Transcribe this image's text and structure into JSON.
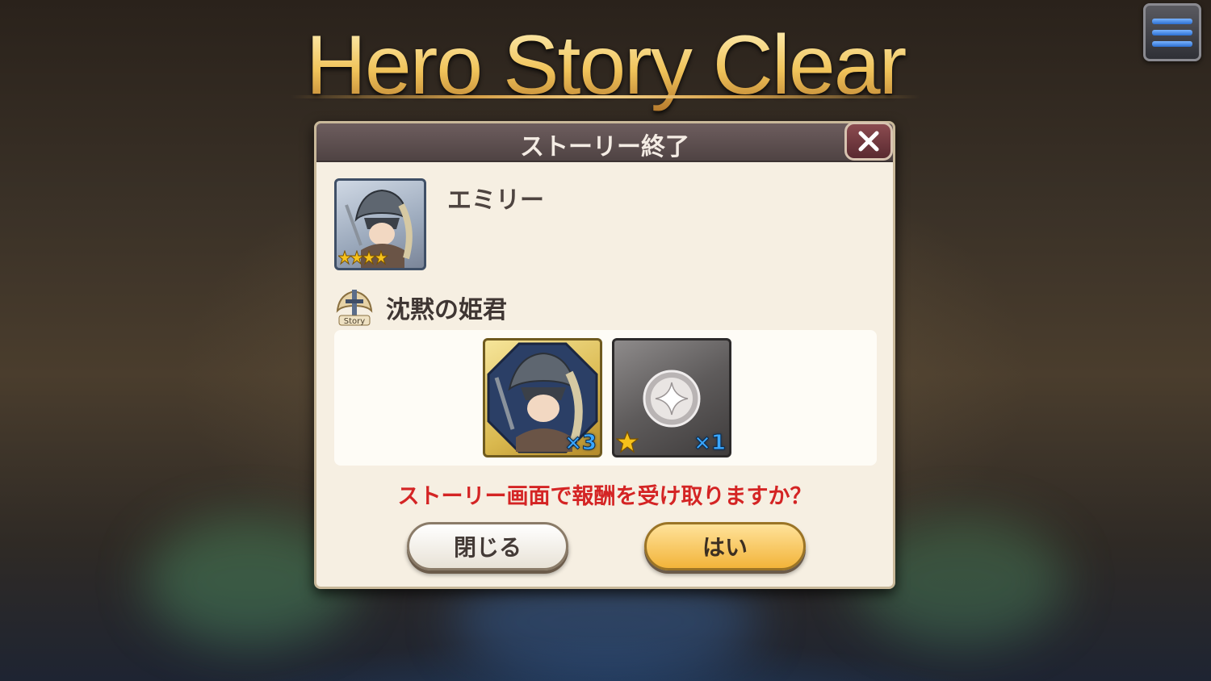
{
  "screen": {
    "title": "Hero Story Clear"
  },
  "menu": {
    "icon": "hamburger-menu-icon"
  },
  "dialog": {
    "title": "ストーリー終了",
    "close_icon": "close-icon",
    "hero": {
      "name": "エミリー",
      "rarity_stars": 4
    },
    "story": {
      "icon": "story-sword-icon",
      "name": "沈黙の姫君"
    },
    "rewards": [
      {
        "type": "hero-fragment",
        "quantity": "×3"
      },
      {
        "type": "silver-medal",
        "rarity_stars": 1,
        "quantity": "×1"
      }
    ],
    "question": "ストーリー画面で報酬を受け取りますか？",
    "buttons": {
      "close_label": "閉じる",
      "yes_label": "はい"
    }
  },
  "colors": {
    "title_gold": "#f0c35a",
    "question_red": "#d42424",
    "yes_button": "#f2b43a"
  }
}
